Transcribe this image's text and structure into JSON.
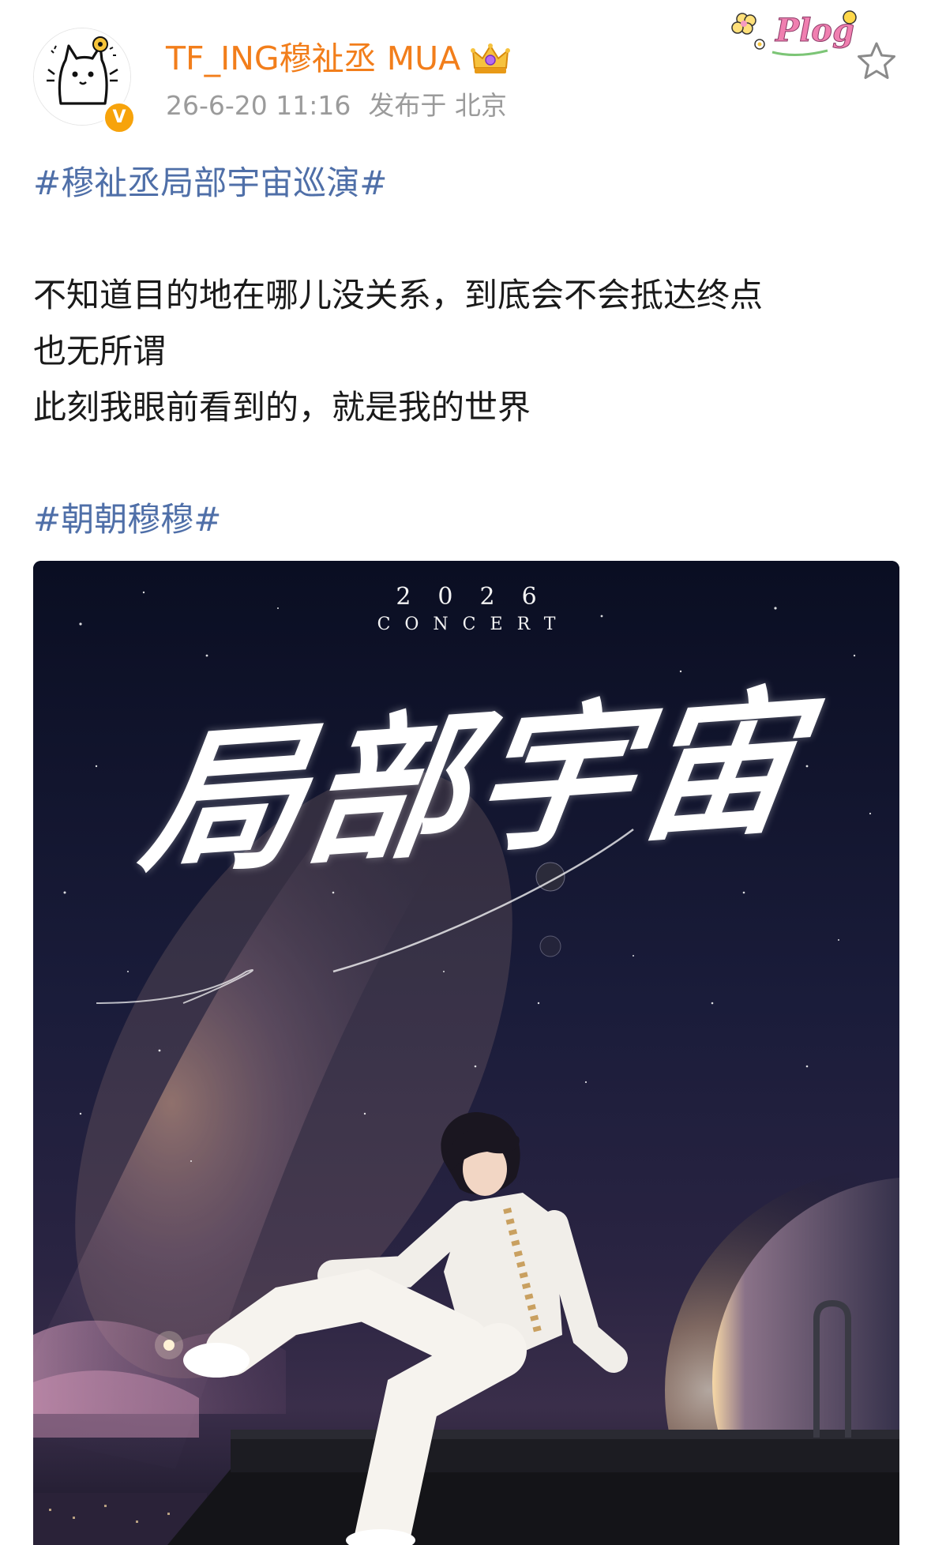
{
  "header": {
    "username": "TF_ING穆祉丞 MUA",
    "timestamp": "26-6-20 11:16",
    "location": "发布于 北京",
    "sticker_text": "Plog",
    "verified_mark": "V"
  },
  "post": {
    "hashtag_top": "#穆祉丞局部宇宙巡演#",
    "lines": [
      "不知道目的地在哪儿没关系，到底会不会抵达终点",
      "也无所谓",
      "此刻我眼前看到的，就是我的世界"
    ],
    "hashtag_bottom": "#朝朝穆穆#"
  },
  "poster": {
    "year": "2026",
    "subtitle": "CONCERT",
    "title": "局部宇宙"
  },
  "colors": {
    "username": "#f27e1b",
    "hashtag": "#4f6fa8",
    "meta": "#9b9b9b",
    "verified": "#f7a30b"
  },
  "icons": {
    "star": "star-outline-icon",
    "crown": "crown-icon",
    "verified": "verified-badge-icon"
  }
}
